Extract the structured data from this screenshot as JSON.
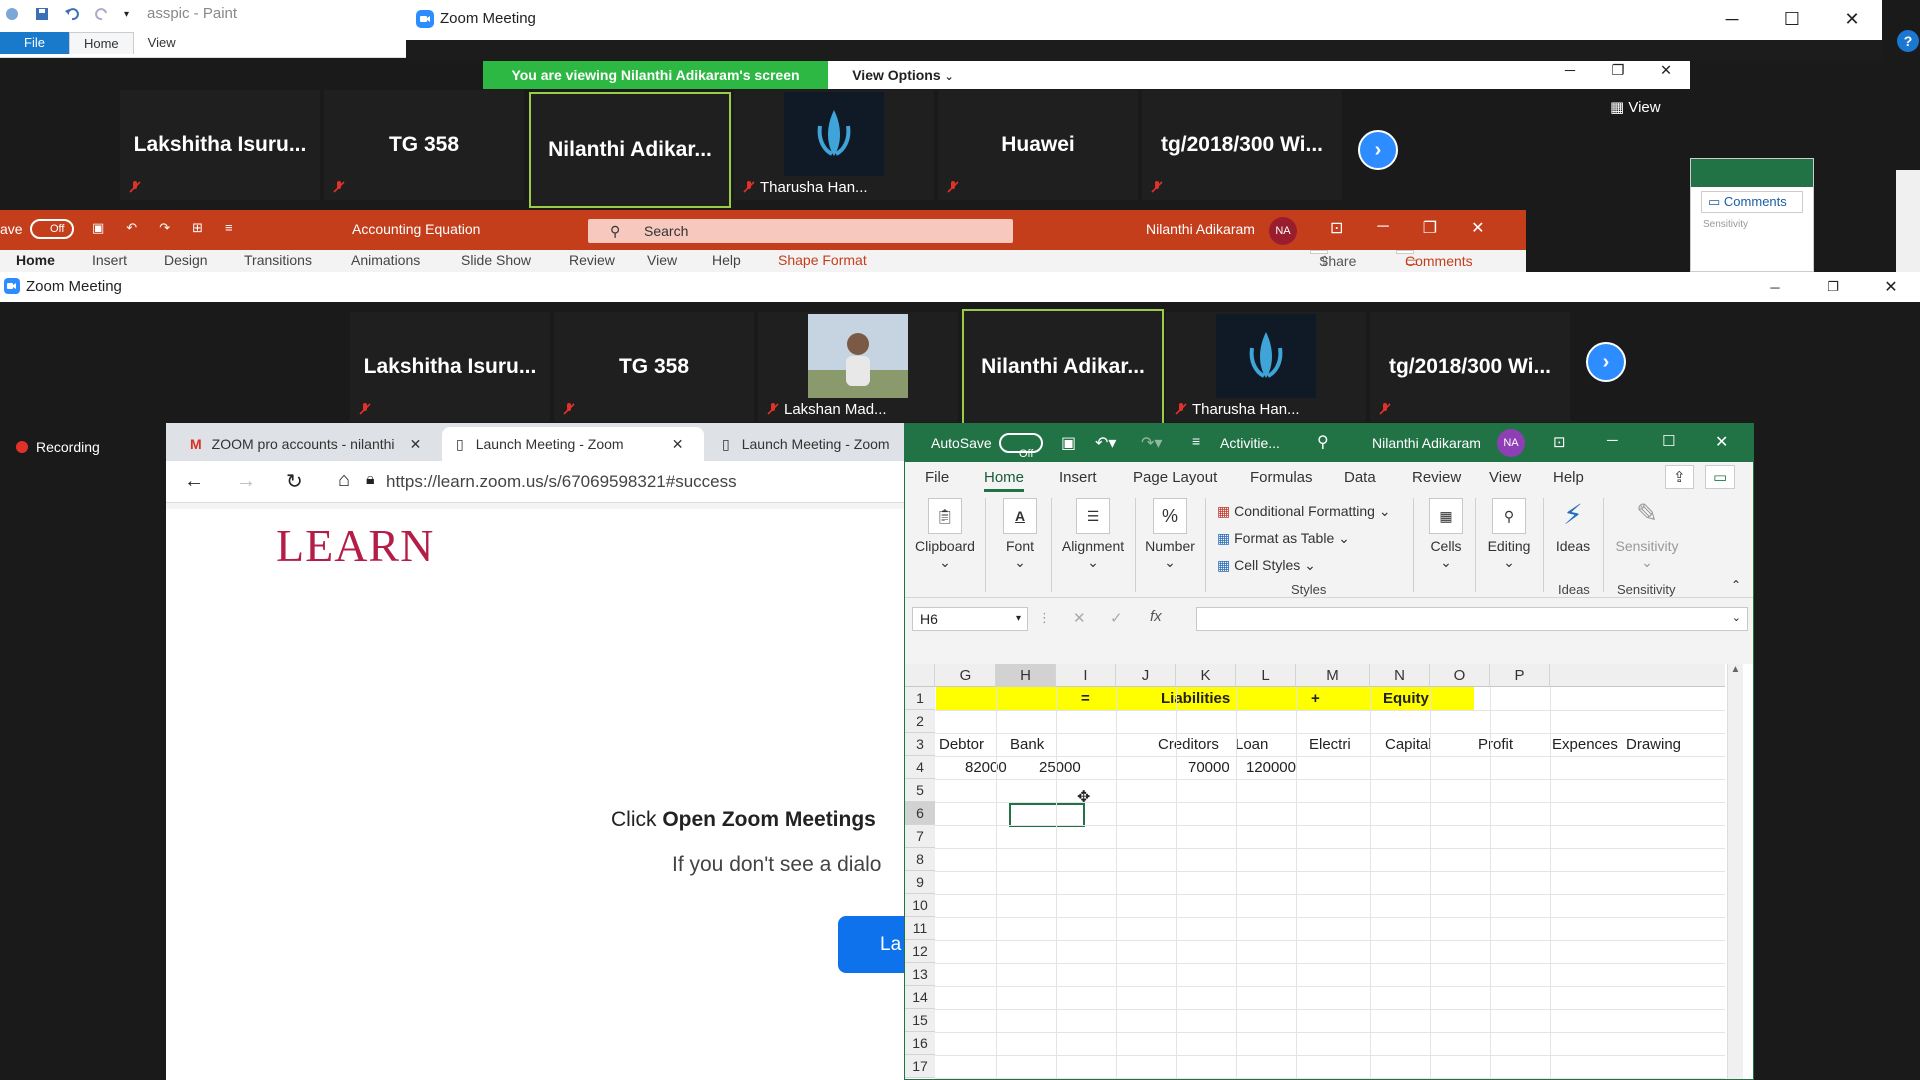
{
  "paint": {
    "title": "asspic - Paint",
    "tabs": [
      "File",
      "Home",
      "View"
    ]
  },
  "zoom_top": {
    "title": "Zoom Meeting",
    "share_banner": "You are viewing Nilanthi Adikaram's screen",
    "view_options": "View Options",
    "view_button": "View",
    "participants": [
      {
        "name": "Lakshitha  Isuru..."
      },
      {
        "name": "TG 358"
      },
      {
        "name": "Nilanthi  Adikar..."
      },
      {
        "name": "Tharusha Han..."
      },
      {
        "name": "Huawei"
      },
      {
        "name": "tg/2018/300  Wi..."
      }
    ]
  },
  "side_panel": {
    "comments": "Comments",
    "sensitivity": "Sensitivity"
  },
  "powerpoint": {
    "autosave": "ave",
    "toggle": "Off",
    "title": "Accounting Equation",
    "search_placeholder": "Search",
    "user": "Nilanthi Adikaram",
    "initials": "NA",
    "menu": [
      "Home",
      "Insert",
      "Design",
      "Transitions",
      "Animations",
      "Slide Show",
      "Review",
      "View",
      "Help",
      "Shape Format"
    ],
    "share": "Share",
    "comments": "Comments"
  },
  "zoom_main": {
    "title": "Zoom Meeting",
    "recording": "Recording",
    "participants": [
      {
        "name": "Lakshitha  Isuru..."
      },
      {
        "name": "TG 358"
      },
      {
        "name": "Lakshan Mad..."
      },
      {
        "name": "Nilanthi  Adikar..."
      },
      {
        "name": "Tharusha Han..."
      },
      {
        "name": "tg/2018/300  Wi..."
      }
    ]
  },
  "browser": {
    "tabs": [
      "ZOOM pro accounts - nilanthi",
      "Launch Meeting - Zoom",
      "Launch Meeting - Zoom"
    ],
    "url": "https://learn.zoom.us/s/67069598321#success",
    "logo": "LEARN",
    "click_prefix": "Click ",
    "click_bold": "Open Zoom Meetings",
    "dialog_line": "If you don't see a dialo",
    "launch_label": "La"
  },
  "excel": {
    "autosave": "AutoSave",
    "toggle": "Off",
    "doc_title": "Activitie...",
    "user": "Nilanthi Adikaram",
    "initials": "NA",
    "menu": [
      "File",
      "Home",
      "Insert",
      "Page Layout",
      "Formulas",
      "Data",
      "Review",
      "View",
      "Help"
    ],
    "ribbon": {
      "clipboard": "Clipboard",
      "font": "Font",
      "alignment": "Alignment",
      "number": "Number",
      "cond_format": "Conditional Formatting",
      "format_table": "Format as Table",
      "cell_styles": "Cell Styles",
      "styles_group": "Styles",
      "cells": "Cells",
      "editing": "Editing",
      "ideas": "Ideas",
      "ideas_group": "Ideas",
      "sensitivity": "Sensitivity",
      "sensitivity_group": "Sensitivity"
    },
    "name_box": "H6",
    "fx": "fx",
    "columns": [
      "G",
      "H",
      "I",
      "J",
      "K",
      "L",
      "M",
      "N",
      "O",
      "P"
    ],
    "rows": [
      "1",
      "2",
      "3",
      "4",
      "5",
      "6",
      "7",
      "8",
      "9",
      "10",
      "11",
      "12",
      "13",
      "14",
      "15",
      "16",
      "17"
    ],
    "cells": {
      "r1_eq": "=",
      "r1_liab": "Liabilities",
      "r1_plus": "+",
      "r1_equity": "Equity",
      "r3": [
        "Debtor",
        "Bank",
        "",
        "Creditors",
        "Loan",
        "Electri",
        "Capital",
        "Profit",
        "Expences",
        "Drawing"
      ],
      "r4_G": "82000",
      "r4_H": "25000",
      "r4_J": "70000",
      "r4_K": "120000"
    },
    "selected_cell": "H6"
  }
}
